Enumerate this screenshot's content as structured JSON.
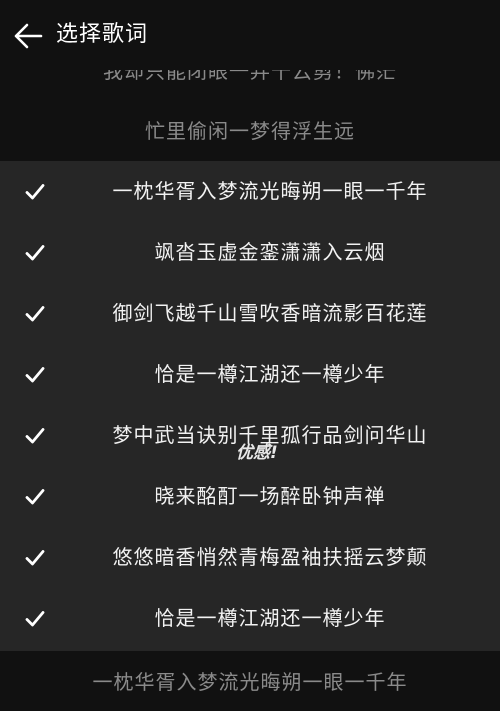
{
  "header": {
    "title": "选择歌词"
  },
  "context": {
    "clipped_line": "我却只能闭眼一弄十云剪！佛茫",
    "before_line": "忙里偷闲一梦得浮生远",
    "after_line": "一枕华胥入梦流光晦朔一眼一千年"
  },
  "selected_lyrics": [
    {
      "text": "一枕华胥入梦流光晦朔一眼一千年",
      "checked": true
    },
    {
      "text": "飒沓玉虚金銮潇潇入云烟",
      "checked": true
    },
    {
      "text": "御剑飞越千山雪吹香暗流影百花莲",
      "checked": true
    },
    {
      "text": "恰是一樽江湖还一樽少年",
      "checked": true
    },
    {
      "text": "梦中武当诀别千里孤行品剑问华山",
      "checked": true
    },
    {
      "text": "晓来酩酊一场醉卧钟声禅",
      "checked": true
    },
    {
      "text": "悠悠暗香悄然青梅盈袖扶摇云梦颠",
      "checked": true
    },
    {
      "text": "恰是一樽江湖还一樽少年",
      "checked": true
    }
  ],
  "watermark": "优感!",
  "colors": {
    "background": "#111111",
    "selected_background": "#262626",
    "text_primary": "#f2f2f2",
    "text_secondary": "#8a8a8a"
  },
  "icons": {
    "back": "arrow-left-icon",
    "check": "checkmark-icon"
  }
}
